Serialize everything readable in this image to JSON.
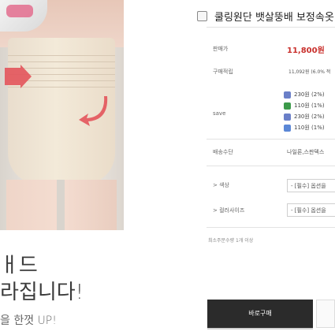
{
  "product": {
    "title": "쿨링원단 뱃살뚱배 보정속옷"
  },
  "info": {
    "sale_label": "판매가",
    "sale_price": "11,800원",
    "reward_label": "구매적립",
    "reward_value": "11,092원 (6.0% 적",
    "save_label": "save",
    "coupons": [
      {
        "text": "230원 (2%)",
        "color": "#6a7fc8"
      },
      {
        "text": "110원 (1%)",
        "color": "#3c9a4a"
      },
      {
        "text": "230원 (2%)",
        "color": "#6a7fc8"
      },
      {
        "text": "110원 (1%)",
        "color": "#5b87d6"
      }
    ],
    "shipping_label": "배송수단",
    "shipping_value": "나일론,스판덱스",
    "option1_label": "> 색상",
    "option1_value": "- [필수] 옵션을",
    "option2_label": "> 컬러사이즈",
    "option2_value": "- [필수] 옵션을",
    "note": "최소주문수량 1개 이상",
    "buy_button": "바로구매"
  },
  "banner": {
    "line1": "ㅐ드",
    "line2": "라집니다!",
    "line3": "을 한껏 UP!"
  },
  "colors": {
    "price_red": "#c9302c",
    "button_dark": "#2b2b2b"
  }
}
